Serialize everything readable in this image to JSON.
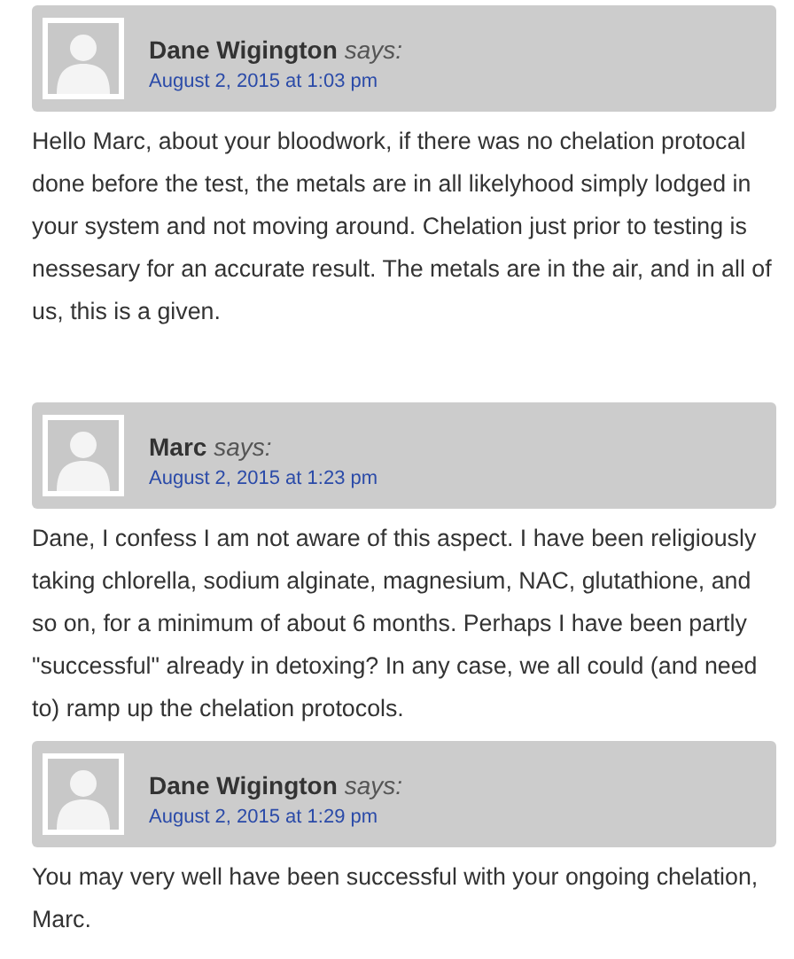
{
  "comments": [
    {
      "author": "Dane Wigington",
      "says": "says:",
      "date": "August 2, 2015 at 1:03 pm",
      "text": "Hello Marc, about your bloodwork, if there was no chelation protocal done before the test, the metals are in all likelyhood simply lodged in your system and not moving around. Chelation just prior to testing is nessesary for an accurate result. The metals are in the air, and in all of us, this is a given.",
      "kind": "top"
    },
    {
      "author": "Marc",
      "says": "says:",
      "date": "August 2, 2015 at 1:23 pm",
      "text": "Dane, I confess I am not aware of this aspect. I have been religiously taking chlorella, sodium alginate, magnesium, NAC, glutathione, and so on, for a minimum of about 6 months. Perhaps I have been partly \"successful\" already in detoxing? In any case, we all could (and need to) ramp up the chelation protocols.",
      "kind": "top"
    },
    {
      "author": "Dane Wigington",
      "says": "says:",
      "date": "August 2, 2015 at 1:29 pm",
      "text": "You may very well have been successful with your ongoing chelation, Marc.",
      "kind": "reply"
    }
  ]
}
